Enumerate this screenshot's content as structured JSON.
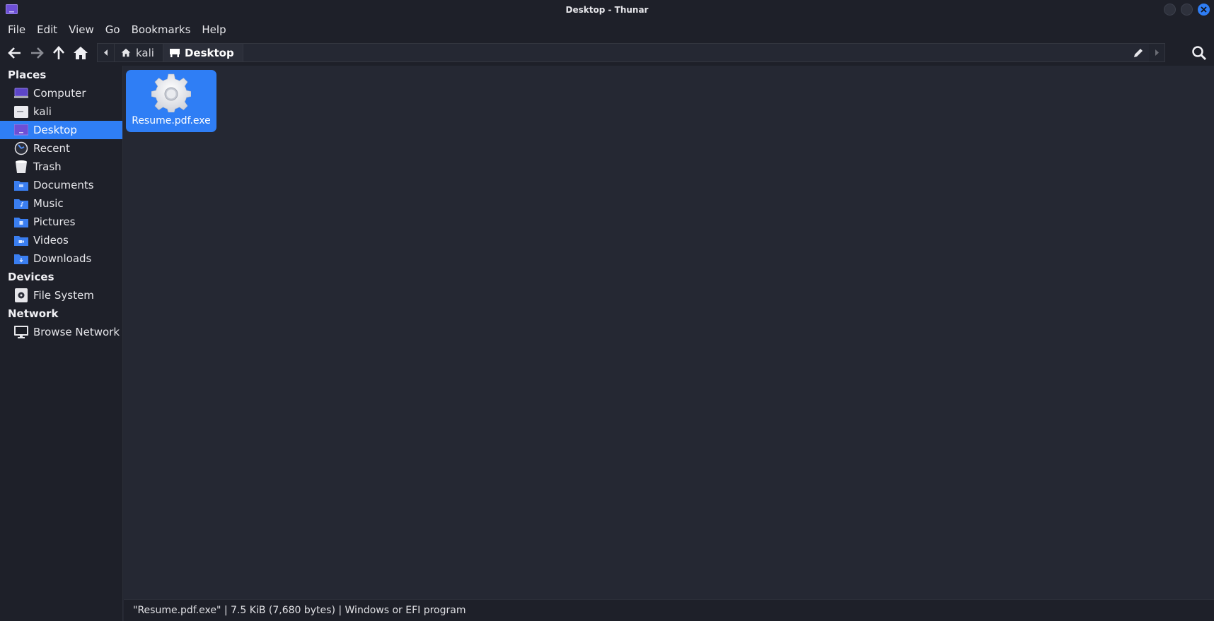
{
  "window": {
    "title": "Desktop - Thunar",
    "accent_color": "#2f7ef5"
  },
  "menubar": {
    "items": [
      "File",
      "Edit",
      "View",
      "Go",
      "Bookmarks",
      "Help"
    ]
  },
  "toolbar": {
    "back_icon": "arrow-left-icon",
    "forward_icon": "arrow-right-icon",
    "up_icon": "arrow-up-icon",
    "home_icon": "home-icon",
    "breadcrumbs": [
      "kali",
      "Desktop"
    ],
    "search_icon": "search-icon"
  },
  "sidebar": {
    "places_title": "Places",
    "places": [
      {
        "label": "Computer",
        "icon": "computer-icon"
      },
      {
        "label": "kali",
        "icon": "home-folder-icon"
      },
      {
        "label": "Desktop",
        "icon": "desktop-icon",
        "selected": true
      },
      {
        "label": "Recent",
        "icon": "recent-icon"
      },
      {
        "label": "Trash",
        "icon": "trash-icon"
      },
      {
        "label": "Documents",
        "icon": "documents-folder-icon"
      },
      {
        "label": "Music",
        "icon": "music-folder-icon"
      },
      {
        "label": "Pictures",
        "icon": "pictures-folder-icon"
      },
      {
        "label": "Videos",
        "icon": "videos-folder-icon"
      },
      {
        "label": "Downloads",
        "icon": "downloads-folder-icon"
      }
    ],
    "devices_title": "Devices",
    "devices": [
      {
        "label": "File System",
        "icon": "drive-icon"
      }
    ],
    "network_title": "Network",
    "network": [
      {
        "label": "Browse Network",
        "icon": "network-icon"
      }
    ]
  },
  "main": {
    "files": [
      {
        "name": "Resume.pdf.exe",
        "icon": "gear-icon",
        "selected": true
      }
    ]
  },
  "statusbar": {
    "text": "\"Resume.pdf.exe\" | 7.5 KiB (7,680 bytes) | Windows or EFI program"
  }
}
